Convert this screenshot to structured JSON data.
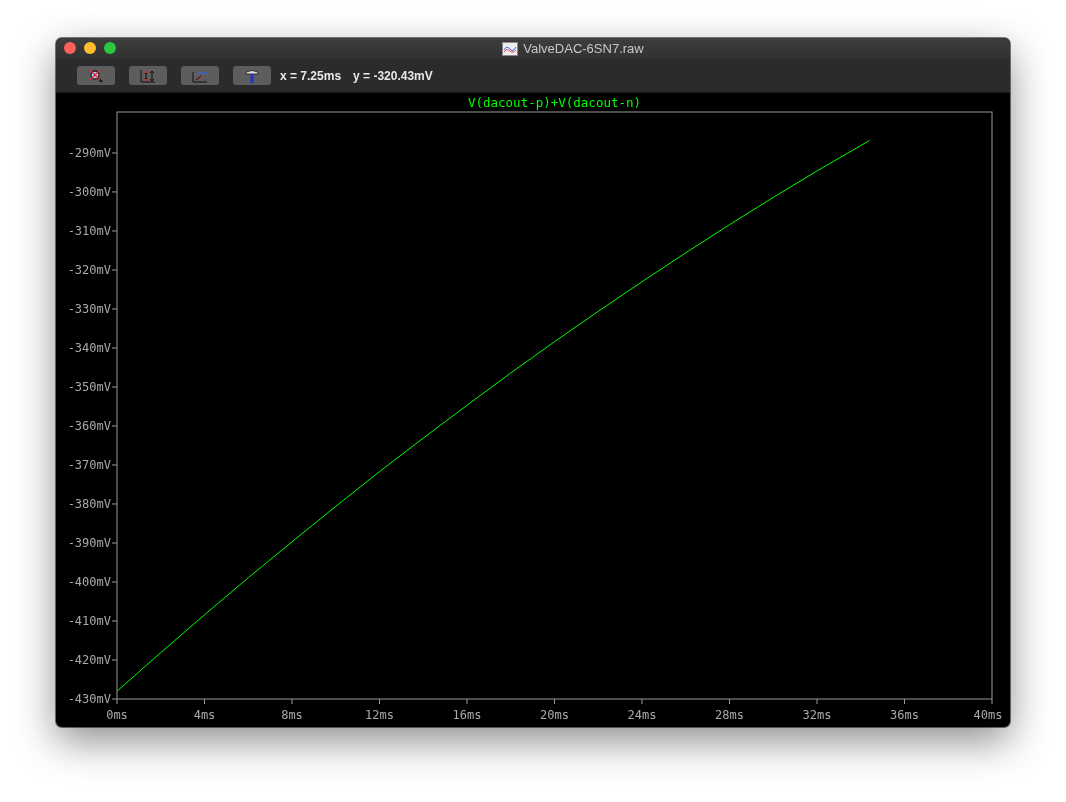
{
  "window": {
    "title": "ValveDAC-6SN7.raw"
  },
  "toolbar": {
    "buttons": [
      {
        "kind": "zoom-cancel"
      },
      {
        "kind": "autorange"
      },
      {
        "kind": "pan"
      },
      {
        "kind": "hammer"
      }
    ],
    "readout_x": "x = 7.25ms",
    "readout_y": "y = -320.43mV"
  },
  "plot": {
    "chart_data": {
      "type": "line",
      "x": [
        0,
        2,
        4,
        6,
        8,
        10,
        12,
        14,
        16,
        18,
        20,
        22,
        24,
        26,
        28,
        30,
        32,
        34,
        34.4
      ],
      "series": [
        {
          "name": "V(dacout-p)+V(dacout-n)",
          "color": "#00ff00",
          "values": [
            -428.0,
            -418.1,
            -408.4,
            -398.9,
            -389.7,
            -380.6,
            -371.7,
            -363.1,
            -354.7,
            -346.4,
            -338.4,
            -330.6,
            -323.0,
            -315.6,
            -308.4,
            -301.4,
            -294.6,
            -288.1,
            -286.8
          ]
        }
      ],
      "xlim": [
        0,
        40
      ],
      "ylim": [
        -430,
        -279.5
      ],
      "xticks": [
        {
          "value": 0,
          "label": "0ms"
        },
        {
          "value": 4,
          "label": "4ms"
        },
        {
          "value": 8,
          "label": "8ms"
        },
        {
          "value": 12,
          "label": "12ms"
        },
        {
          "value": 16,
          "label": "16ms"
        },
        {
          "value": 20,
          "label": "20ms"
        },
        {
          "value": 24,
          "label": "24ms"
        },
        {
          "value": 28,
          "label": "28ms"
        },
        {
          "value": 32,
          "label": "32ms"
        },
        {
          "value": 36,
          "label": "36ms"
        },
        {
          "value": 40,
          "label": "40ms"
        }
      ],
      "yticks": [
        {
          "value": -290,
          "label": "-290mV"
        },
        {
          "value": -300,
          "label": "-300mV"
        },
        {
          "value": -310,
          "label": "-310mV"
        },
        {
          "value": -320,
          "label": "-320mV"
        },
        {
          "value": -330,
          "label": "-330mV"
        },
        {
          "value": -340,
          "label": "-340mV"
        },
        {
          "value": -350,
          "label": "-350mV"
        },
        {
          "value": -360,
          "label": "-360mV"
        },
        {
          "value": -370,
          "label": "-370mV"
        },
        {
          "value": -380,
          "label": "-380mV"
        },
        {
          "value": -390,
          "label": "-390mV"
        },
        {
          "value": -400,
          "label": "-400mV"
        },
        {
          "value": -410,
          "label": "-410mV"
        },
        {
          "value": -420,
          "label": "-420mV"
        },
        {
          "value": -430,
          "label": "-430mV"
        }
      ]
    }
  }
}
